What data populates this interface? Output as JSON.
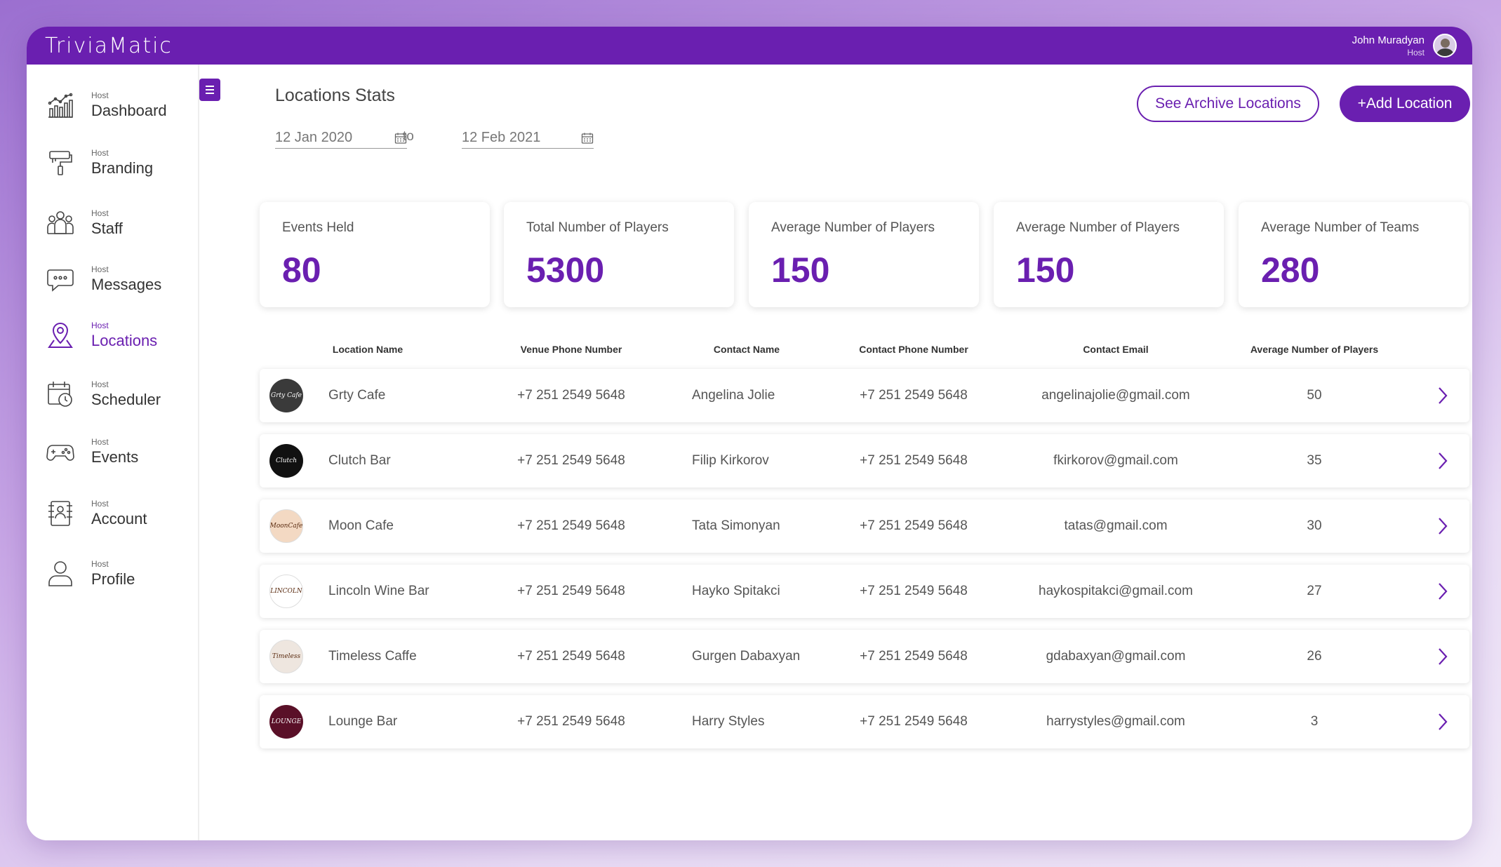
{
  "app": {
    "logo": "TriviaMatic"
  },
  "user": {
    "name": "John Muradyan",
    "role": "Host"
  },
  "sidebar": {
    "items": [
      {
        "small": "Host",
        "label": "Dashboard",
        "icon": "dashboard-chart-icon"
      },
      {
        "small": "Host",
        "label": "Branding",
        "icon": "paint-roller-icon"
      },
      {
        "small": "Host",
        "label": "Staff",
        "icon": "staff-group-icon"
      },
      {
        "small": "Host",
        "label": "Messages",
        "icon": "chat-bubble-icon"
      },
      {
        "small": "Host",
        "label": "Locations",
        "icon": "location-pin-icon",
        "active": true
      },
      {
        "small": "Host",
        "label": "Scheduler",
        "icon": "calendar-clock-icon"
      },
      {
        "small": "Host",
        "label": "Events",
        "icon": "gamepad-icon"
      },
      {
        "small": "Host",
        "label": "Account",
        "icon": "account-card-icon"
      },
      {
        "small": "Host",
        "label": "Profile",
        "icon": "user-profile-icon"
      }
    ]
  },
  "main": {
    "title": "Locations Stats",
    "archive_button": "See Archive Locations",
    "add_button": "+Add Location",
    "date_from": "12 Jan 2020",
    "date_sep": "to",
    "date_to": "12 Feb 2021"
  },
  "stats": [
    {
      "label": "Events Held",
      "value": "80"
    },
    {
      "label": "Total Number of Players",
      "value": "5300"
    },
    {
      "label": "Average Number of Players",
      "value": "150"
    },
    {
      "label": "Average Number of Players",
      "value": "150"
    },
    {
      "label": "Average Number of Teams",
      "value": "280"
    }
  ],
  "table": {
    "headers": [
      "Location Name",
      "Venue Phone Number",
      "Contact Name",
      "Contact Phone Number",
      "Contact Email",
      "Average Number of Players"
    ],
    "rows": [
      {
        "logo_text": "Grty Cafe",
        "name": "Grty Cafe",
        "venue_phone": "+7 251 2549 5648",
        "contact": "Angelina Jolie",
        "contact_phone": "+7 251 2549 5648",
        "email": "angelinajolie@gmail.com",
        "avg": "50",
        "logo_color": "#3a3a3a"
      },
      {
        "logo_text": "Clutch",
        "name": "Clutch Bar",
        "venue_phone": "+7 251 2549 5648",
        "contact": "Filip Kirkorov",
        "contact_phone": "+7 251 2549 5648",
        "email": "fkirkorov@gmail.com",
        "avg": "35",
        "logo_color": "#111111"
      },
      {
        "logo_text": "MoonCafe",
        "name": "Moon Cafe",
        "venue_phone": "+7 251 2549 5648",
        "contact": "Tata Simonyan",
        "contact_phone": "+7 251 2549 5648",
        "email": "tatas@gmail.com",
        "avg": "30",
        "logo_color": "#f3d9c3"
      },
      {
        "logo_text": "LINCOLN",
        "name": "Lincoln Wine Bar",
        "venue_phone": "+7 251 2549 5648",
        "contact": "Hayko Spitakci",
        "contact_phone": "+7 251 2549 5648",
        "email": "haykospitakci@gmail.com",
        "avg": "27",
        "logo_color": "#ffffff"
      },
      {
        "logo_text": "Timeless",
        "name": "Timeless Caffe",
        "venue_phone": "+7 251 2549 5648",
        "contact": "Gurgen Dabaxyan",
        "contact_phone": "+7 251 2549 5648",
        "email": "gdabaxyan@gmail.com",
        "avg": "26",
        "logo_color": "#eee6df"
      },
      {
        "logo_text": "LOUNGE",
        "name": "Lounge Bar",
        "venue_phone": "+7 251 2549 5648",
        "contact": "Harry Styles",
        "contact_phone": "+7 251 2549 5648",
        "email": "harrystyles@gmail.com",
        "avg": "3",
        "logo_color": "#5a1028"
      }
    ]
  },
  "colors": {
    "accent": "#6a1fb0",
    "background": "#ffffff"
  }
}
